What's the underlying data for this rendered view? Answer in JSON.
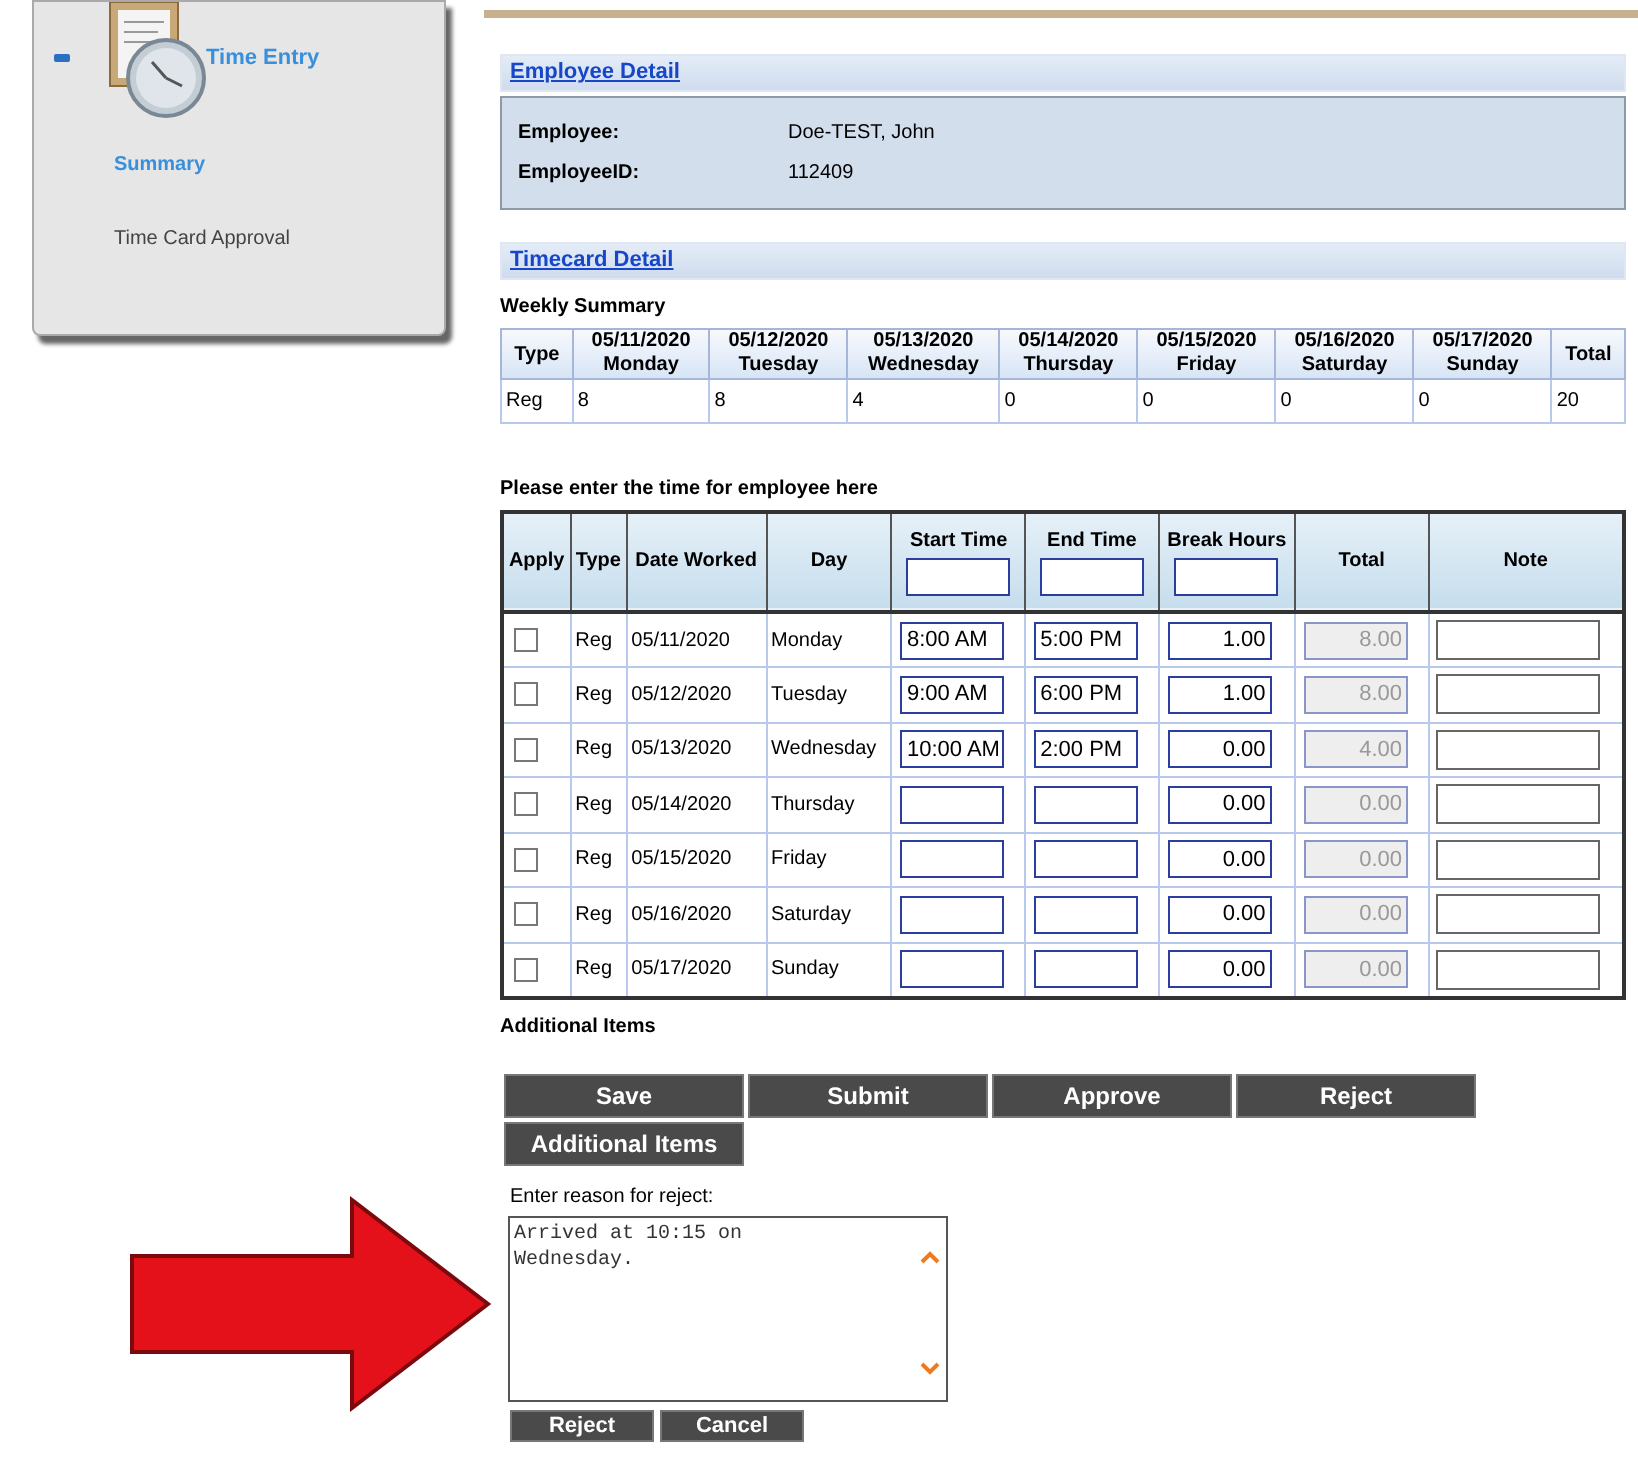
{
  "sidebar": {
    "title": "Time Entry",
    "expanded": true,
    "items": [
      {
        "label": "Summary",
        "selected": true
      },
      {
        "label": "Time Card Approval",
        "selected": false
      }
    ]
  },
  "employee_detail": {
    "heading": "Employee Detail",
    "fields": [
      {
        "label": "Employee:",
        "value": "Doe-TEST, John"
      },
      {
        "label": "EmployeeID:",
        "value": "112409"
      }
    ]
  },
  "timecard_detail": {
    "heading": "Timecard Detail",
    "summary_title": "Weekly Summary",
    "type_heading": "Type",
    "total_heading": "Total",
    "days": [
      {
        "date": "05/11/2020",
        "day": "Monday"
      },
      {
        "date": "05/12/2020",
        "day": "Tuesday"
      },
      {
        "date": "05/13/2020",
        "day": "Wednesday"
      },
      {
        "date": "05/14/2020",
        "day": "Thursday"
      },
      {
        "date": "05/15/2020",
        "day": "Friday"
      },
      {
        "date": "05/16/2020",
        "day": "Saturday"
      },
      {
        "date": "05/17/2020",
        "day": "Sunday"
      }
    ],
    "rows": [
      {
        "type": "Reg",
        "values": [
          "8",
          "8",
          "4",
          "0",
          "0",
          "0",
          "0"
        ],
        "total": "20"
      }
    ]
  },
  "entry": {
    "title": "Please enter the time for employee here",
    "columns": [
      {
        "label": "Apply",
        "has_field": false
      },
      {
        "label": "Type",
        "has_field": false
      },
      {
        "label": "Date Worked",
        "has_field": false
      },
      {
        "label": "Day",
        "has_field": false
      },
      {
        "label": "Start Time",
        "has_field": true
      },
      {
        "label": "End Time",
        "has_field": true
      },
      {
        "label": "Break Hours",
        "has_field": true
      },
      {
        "label": "Total",
        "has_field": false
      },
      {
        "label": "Note",
        "has_field": false
      }
    ],
    "rows": [
      {
        "checked": false,
        "type": "Reg",
        "date": "05/11/2020",
        "day": "Monday",
        "start": "8:00 AM",
        "end": "5:00 PM",
        "break": "1.00",
        "total": "8.00"
      },
      {
        "checked": false,
        "type": "Reg",
        "date": "05/12/2020",
        "day": "Tuesday",
        "start": "9:00 AM",
        "end": "6:00 PM",
        "break": "1.00",
        "total": "8.00"
      },
      {
        "checked": false,
        "type": "Reg",
        "date": "05/13/2020",
        "day": "Wednesday",
        "start": "10:00 AM",
        "end": "2:00 PM",
        "break": "0.00",
        "total": "4.00"
      },
      {
        "checked": false,
        "type": "Reg",
        "date": "05/14/2020",
        "day": "Thursday",
        "break": "0.00",
        "total": "0.00"
      },
      {
        "checked": false,
        "type": "Reg",
        "date": "05/15/2020",
        "day": "Friday",
        "break": "0.00",
        "total": "0.00"
      },
      {
        "checked": false,
        "type": "Reg",
        "date": "05/16/2020",
        "day": "Saturday",
        "break": "0.00",
        "total": "0.00"
      },
      {
        "checked": false,
        "type": "Reg",
        "date": "05/17/2020",
        "day": "Sunday",
        "break": "0.00",
        "total": "0.00"
      }
    ]
  },
  "additional_items_label": "Additional Items",
  "buttons": [
    "Save",
    "Submit",
    "Approve",
    "Reject",
    "Additional Items"
  ],
  "reject": {
    "label": "Enter reason for reject:",
    "value": "Arrived at 10:15 on\nWednesday.",
    "buttons": [
      "Reject",
      "Cancel"
    ]
  }
}
